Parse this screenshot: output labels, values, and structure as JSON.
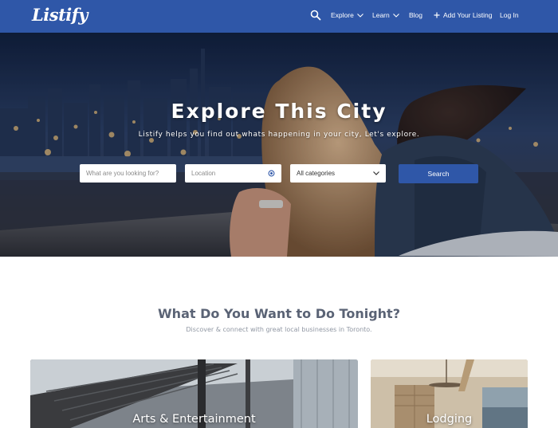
{
  "brand": {
    "logo": "Listify",
    "accent": "#2f57a8"
  },
  "nav": {
    "search_icon": "search-icon",
    "items": [
      {
        "label": "Explore",
        "has_dropdown": true
      },
      {
        "label": "Learn",
        "has_dropdown": true
      },
      {
        "label": "Blog",
        "has_dropdown": false
      },
      {
        "label": "Add Your Listing",
        "icon": "plus-icon"
      },
      {
        "label": "Log In",
        "has_dropdown": false
      }
    ]
  },
  "hero": {
    "title": "Explore This City",
    "subtitle": "Listify helps you find out whats happening in your city, Let's explore.",
    "search": {
      "what_placeholder": "What are you looking for?",
      "what_value": "",
      "location_placeholder": "Location",
      "location_value": "",
      "location_icon": "locate-icon",
      "category_selected": "All categories",
      "category_icon": "chevron-down-icon",
      "button_label": "Search"
    }
  },
  "section": {
    "title": "What Do You Want to Do Tonight?",
    "subtitle": "Discover & connect with great local businesses in Toronto."
  },
  "categories": [
    {
      "label": "Arts & Entertainment"
    },
    {
      "label": "Lodging"
    }
  ]
}
